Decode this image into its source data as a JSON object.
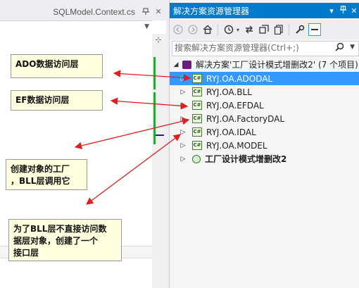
{
  "editor": {
    "tab_title": "SQLModel.Context.cs",
    "tab_pin_icon": "pin-icon",
    "tab_close_icon": "close-icon"
  },
  "solution_explorer": {
    "title": "解决方案资源管理器",
    "title_controls": [
      "dropdown-icon",
      "pin-icon",
      "close-icon"
    ],
    "search_placeholder": "搜索解决方案资源管理器(Ctrl+;)",
    "toolbar_icons": [
      "back-icon",
      "forward-icon",
      "home-icon",
      "history-icon",
      "sync-icon",
      "collapse-all-icon",
      "show-all-files-icon",
      "properties-icon",
      "preview-icon"
    ],
    "solution_label": "解决方案'工厂设计模式增删改2' (7 个项目)",
    "projects": [
      {
        "name": "RYJ.OA.ADODAL",
        "selected": true,
        "icon": "csharp-project-icon"
      },
      {
        "name": "RYJ.OA.BLL",
        "selected": false,
        "icon": "csharp-project-icon"
      },
      {
        "name": "RYJ.OA.EFDAL",
        "selected": false,
        "icon": "csharp-project-icon"
      },
      {
        "name": "RYJ.OA.FactoryDAL",
        "selected": false,
        "icon": "csharp-project-icon"
      },
      {
        "name": "RYJ.OA.IDAL",
        "selected": false,
        "icon": "csharp-project-icon"
      },
      {
        "name": "RYJ.OA.MODEL",
        "selected": false,
        "icon": "csharp-project-icon"
      },
      {
        "name": "工厂设计模式增删改2",
        "selected": false,
        "icon": "web-project-icon",
        "bold": true
      }
    ],
    "project_icon_text": "C#"
  },
  "annotations": {
    "ado": "ADO数据访问层",
    "ef": "EF数据访问层",
    "factory_line1": "创建对象的工厂",
    "factory_line2": "，BLL层调用它",
    "idal_line1": "为了BLL层不直接访问数",
    "idal_line2": "据层对象，创建了一个",
    "idal_line3": "接口层"
  },
  "colors": {
    "accent": "#007acc",
    "selection": "#3399ff",
    "arrow": "#e02020",
    "note_bg": "#ffffe0",
    "change_bar": "#2aa63a"
  }
}
